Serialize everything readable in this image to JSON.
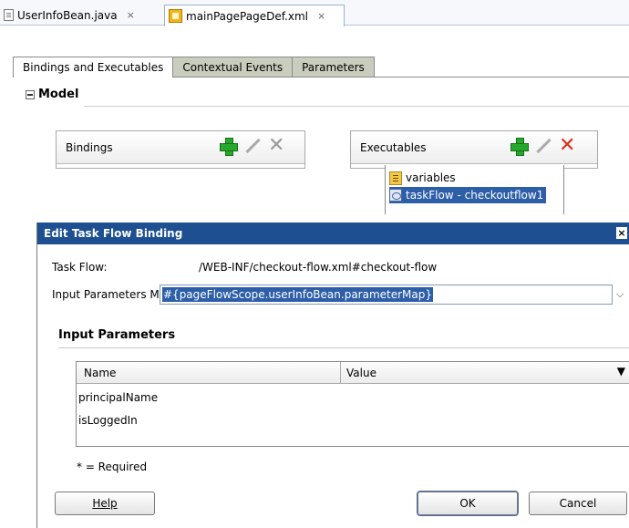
{
  "editor_tabs": [
    {
      "label": "UserInfoBean.java",
      "close": "×"
    },
    {
      "label": "mainPagePageDef.xml",
      "close": "×"
    }
  ],
  "sub_tabs": [
    "Bindings and Executables",
    "Contextual Events",
    "Parameters"
  ],
  "model": {
    "heading": "Model"
  },
  "bindings_panel": {
    "title": "Bindings"
  },
  "executables_panel": {
    "title": "Executables",
    "items": [
      "variables",
      "taskFlow - checkoutflow1"
    ]
  },
  "dialog": {
    "title": "Edit Task Flow Binding",
    "close_glyph": "×",
    "task_flow_label": "Task Flow:",
    "task_flow_value": "/WEB-INF/checkout-flow.xml#checkout-flow",
    "map_label": "Input Parameters Map:",
    "map_value": "#{pageFlowScope.userInfoBean.parameterMap}",
    "section_title": "Input Parameters",
    "columns": [
      "Name",
      "Value"
    ],
    "rows": [
      "principalName",
      "isLoggedIn"
    ],
    "required_note": "* = Required",
    "help_button": "Help",
    "ok_button": "OK",
    "cancel_button": "Cancel"
  },
  "colors": {
    "title_bar": "#1d4f91",
    "selection": "#2d5ea8",
    "add_icon": "#27a82d",
    "delete_icon": "#d9301c",
    "inactive_tab": "#c9cdbd"
  }
}
